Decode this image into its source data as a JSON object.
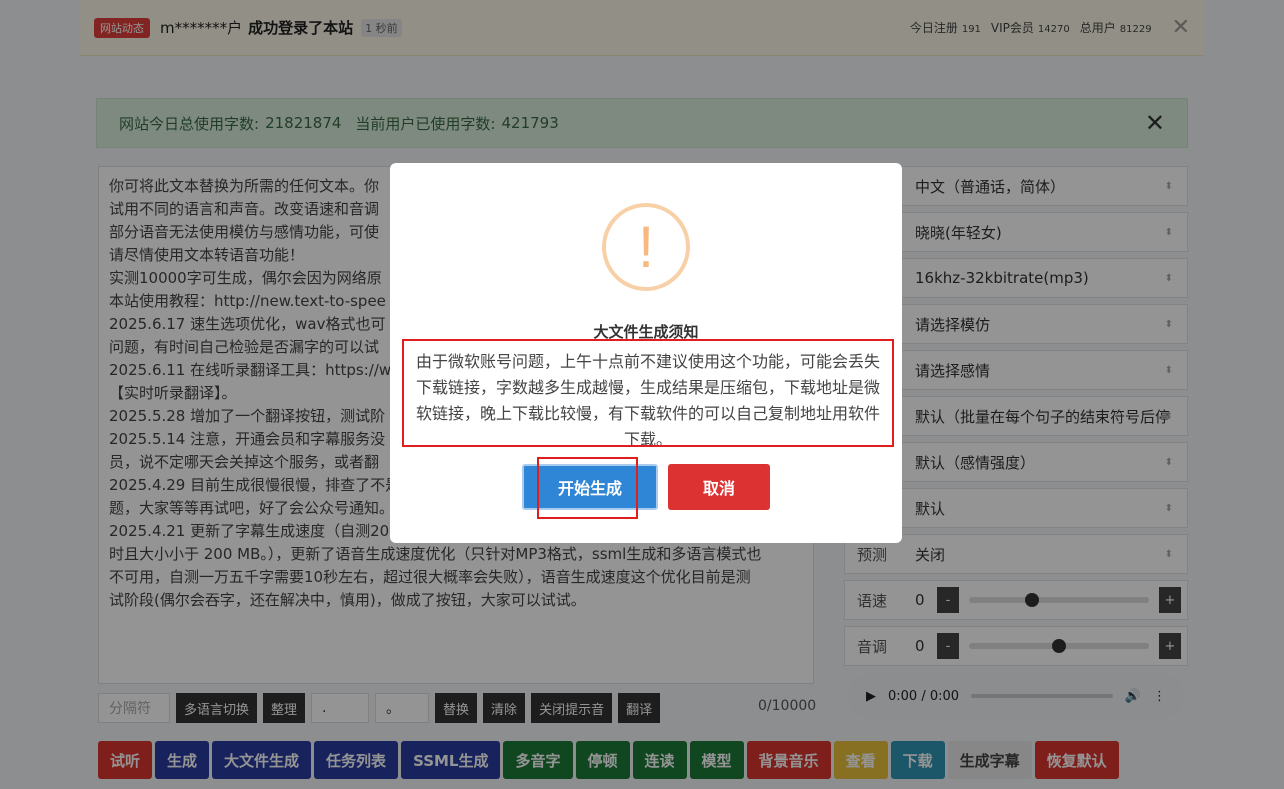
{
  "topbar": {
    "badge": "网站动态",
    "user": "m*******户",
    "message": "成功登录了本站",
    "ago": "1 秒前",
    "stats": [
      {
        "label": "今日注册",
        "value": "191"
      },
      {
        "label": "VIP会员",
        "value": "14270"
      },
      {
        "label": "总用户",
        "value": "81229"
      }
    ],
    "close": "✕"
  },
  "usage": {
    "total_label": "网站今日总使用字数:",
    "total_value": "21821874",
    "user_label": "当前用户已使用字数:",
    "user_value": "421793",
    "close": "✕"
  },
  "textbox": {
    "lines": [
      "你可将此文本替换为所需的任何文本。你",
      "试用不同的语言和声音。改变语速和音调",
      "部分语音无法使用模仿与感情功能，可使",
      "请尽情使用文本转语音功能！",
      "实测10000字可生成，偶尔会因为网络原",
      "本站使用教程：http://new.text-to-spee",
      "",
      "2025.6.17 速生选项优化，wav格式也可",
      "问题，有时间自己检验是否漏字的可以试",
      "",
      "2025.6.11 在线听录翻译工具：https://w",
      "【实时听录翻译】。",
      "2025.5.28 增加了一个翻译按钮，测试阶",
      "2025.5.14 注意，开通会员和字幕服务没",
      "员，说不定哪天会关掉这个服务，或者翻",
      "2025.4.29 目前生成很慢很慢，排查了不是服务器问题，换号测试发现应该是微软服务出现了问",
      "题，大家等等再试吧，好了会公众号通知。",
      "2025.4.21 更新了字幕生成速度（自测20分钟的音频需要50秒左右，音频文件需要长度小于 2 小",
      "时且大小小于 200 MB。），更新了语音生成速度优化（只针对MP3格式，ssml生成和多语言模式也",
      "不可用，自测一万五千字需要10秒左右，超过很大概率会失败），语音生成速度这个优化目前是测",
      "试阶段(偶尔会吞字，还在解决中，慎用)，做成了按钮，大家可以试试。"
    ]
  },
  "toolbar": {
    "separator_placeholder": "分隔符",
    "multi_lang": "多语言切换",
    "tidy": "整理",
    "find_value": ".",
    "replace_value": "。",
    "replace": "替换",
    "clear": "清除",
    "close_tip": "关闭提示音",
    "translate": "翻译",
    "counter": "0/10000"
  },
  "selects": {
    "language": "中文（普通话，简体）",
    "voice": "晓晓(年轻女)",
    "format": "16khz-32kbitrate(mp3)",
    "mimic": "请选择模仿",
    "emotion": "请选择感情",
    "pause": "默认（批量在每个句子的结束符号后停",
    "intensity": "默认（感情强度）",
    "other": "默认",
    "preview_label": "预测",
    "preview_value": "关闭"
  },
  "sliders": {
    "rate_label": "语速",
    "rate_value": "0",
    "pitch_label": "音调",
    "pitch_value": "0",
    "minus": "-",
    "plus": "+",
    "rate_fraction": 0.35,
    "pitch_fraction": 0.5
  },
  "audio": {
    "time": "0:00 / 0:00"
  },
  "bottom_buttons": {
    "listen": "试听",
    "generate": "生成",
    "big_file": "大文件生成",
    "tasks": "任务列表",
    "ssml": "SSML生成",
    "polyphone": "多音字",
    "pause": "停顿",
    "continuous": "连读",
    "model": "模型",
    "bgm": "背景音乐",
    "view": "查看",
    "download": "下载",
    "subtitle": "生成字幕",
    "reset": "恢复默认"
  },
  "modal": {
    "icon": "!",
    "title": "大文件生成须知",
    "body": "由于微软账号问题，上午十点前不建议使用这个功能，可能会丢失下载链接，字数越多生成越慢，生成结果是压缩包，下载地址是微软链接，晚上下载比较慢，有下载软件的可以自己复制地址用软件下载。",
    "confirm": "开始生成",
    "cancel": "取消"
  }
}
